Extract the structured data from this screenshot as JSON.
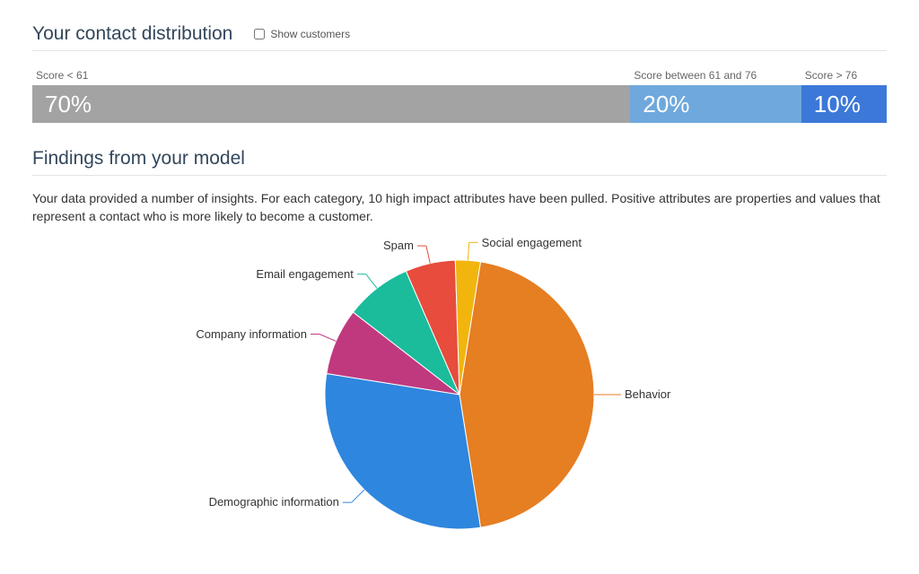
{
  "distribution": {
    "title": "Your contact distribution",
    "checkbox_label": "Show customers",
    "segments": [
      {
        "label": "Score < 61",
        "percent_text": "70%",
        "percent": 70,
        "class": "low"
      },
      {
        "label": "Score between 61 and 76",
        "percent_text": "20%",
        "percent": 20,
        "class": "mid"
      },
      {
        "label": "Score > 76",
        "percent_text": "10%",
        "percent": 10,
        "class": "high"
      }
    ]
  },
  "findings": {
    "title": "Findings from your model",
    "description": "Your data provided a number of insights. For each category, 10 high impact attributes have been pulled. Positive attributes are properties and values that represent a contact who is more likely to become a customer."
  },
  "chart_data": {
    "type": "pie",
    "title": "",
    "series": [
      {
        "name": "Behavior",
        "value": 45,
        "color": "#e67e22"
      },
      {
        "name": "Demographic information",
        "value": 30,
        "color": "#2e86de"
      },
      {
        "name": "Company information",
        "value": 8,
        "color": "#c0397f"
      },
      {
        "name": "Email engagement",
        "value": 8,
        "color": "#1abc9c"
      },
      {
        "name": "Spam",
        "value": 6,
        "color": "#e74c3c"
      },
      {
        "name": "Social engagement",
        "value": 3,
        "color": "#f1b50e"
      }
    ]
  }
}
